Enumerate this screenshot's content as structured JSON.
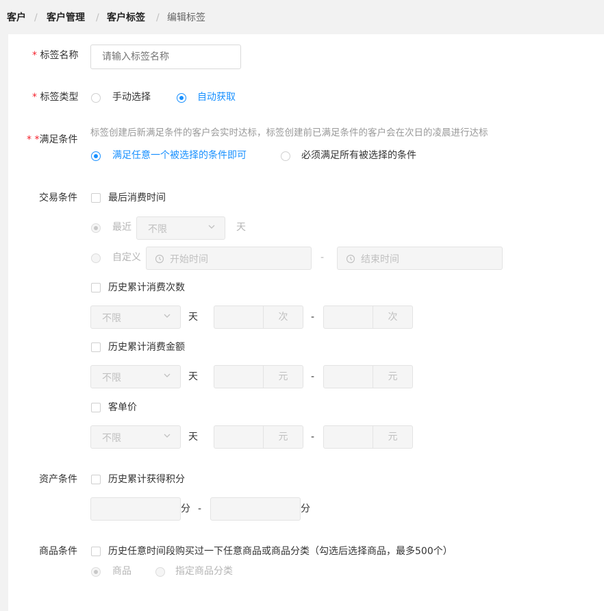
{
  "breadcrumb": {
    "items": [
      "客户",
      "客户管理",
      "客户标签",
      "编辑标签"
    ],
    "separator": "/"
  },
  "form": {
    "tag_name": {
      "required_mark": "*",
      "label": "标签名称",
      "placeholder": "请输入标签名称"
    },
    "tag_type": {
      "required_mark": "*",
      "label": "标签类型",
      "options": [
        {
          "label": "手动选择",
          "selected": false
        },
        {
          "label": "自动获取",
          "selected": true
        }
      ]
    },
    "conditions": {
      "required_mark": "* *",
      "label": "满足条件",
      "hint": "标签创建后新满足条件的客户会实时达标，标签创建前已满足条件的客户会在次日的凌晨进行达标",
      "options": [
        {
          "label": "满足任意一个被选择的条件即可",
          "selected": true
        },
        {
          "label": "必须满足所有被选择的条件",
          "selected": false
        }
      ]
    },
    "trade": {
      "label": "交易条件",
      "last_consume": {
        "label": "最后消费时间",
        "recent_label": "最近",
        "recent_value": "不限",
        "day_unit": "天",
        "custom_label": "自定义",
        "start_placeholder": "开始时间",
        "end_placeholder": "结束时间",
        "range_sep": "-"
      },
      "consume_count": {
        "label": "历史累计消费次数",
        "select_value": "不限",
        "day_unit": "天",
        "addon": "次",
        "range_sep": "-"
      },
      "consume_amount": {
        "label": "历史累计消费金额",
        "select_value": "不限",
        "day_unit": "天",
        "addon": "元",
        "range_sep": "-"
      },
      "unit_price": {
        "label": "客单价",
        "select_value": "不限",
        "day_unit": "天",
        "addon": "元",
        "range_sep": "-"
      }
    },
    "asset": {
      "label": "资产条件",
      "points": {
        "label": "历史累计获得积分",
        "unit": "分",
        "range_sep": "-"
      }
    },
    "goods": {
      "label": "商品条件",
      "purchase_label": "历史任意时间段购买过一下任意商品或商品分类（勾选后选择商品，最多500个）",
      "options": [
        {
          "label": "商品",
          "selected": true
        },
        {
          "label": "指定商品分类",
          "selected": false
        }
      ]
    }
  },
  "colors": {
    "primary": "#1890ff",
    "required": "#f5222d",
    "disabled_bg": "#f5f5f5"
  }
}
